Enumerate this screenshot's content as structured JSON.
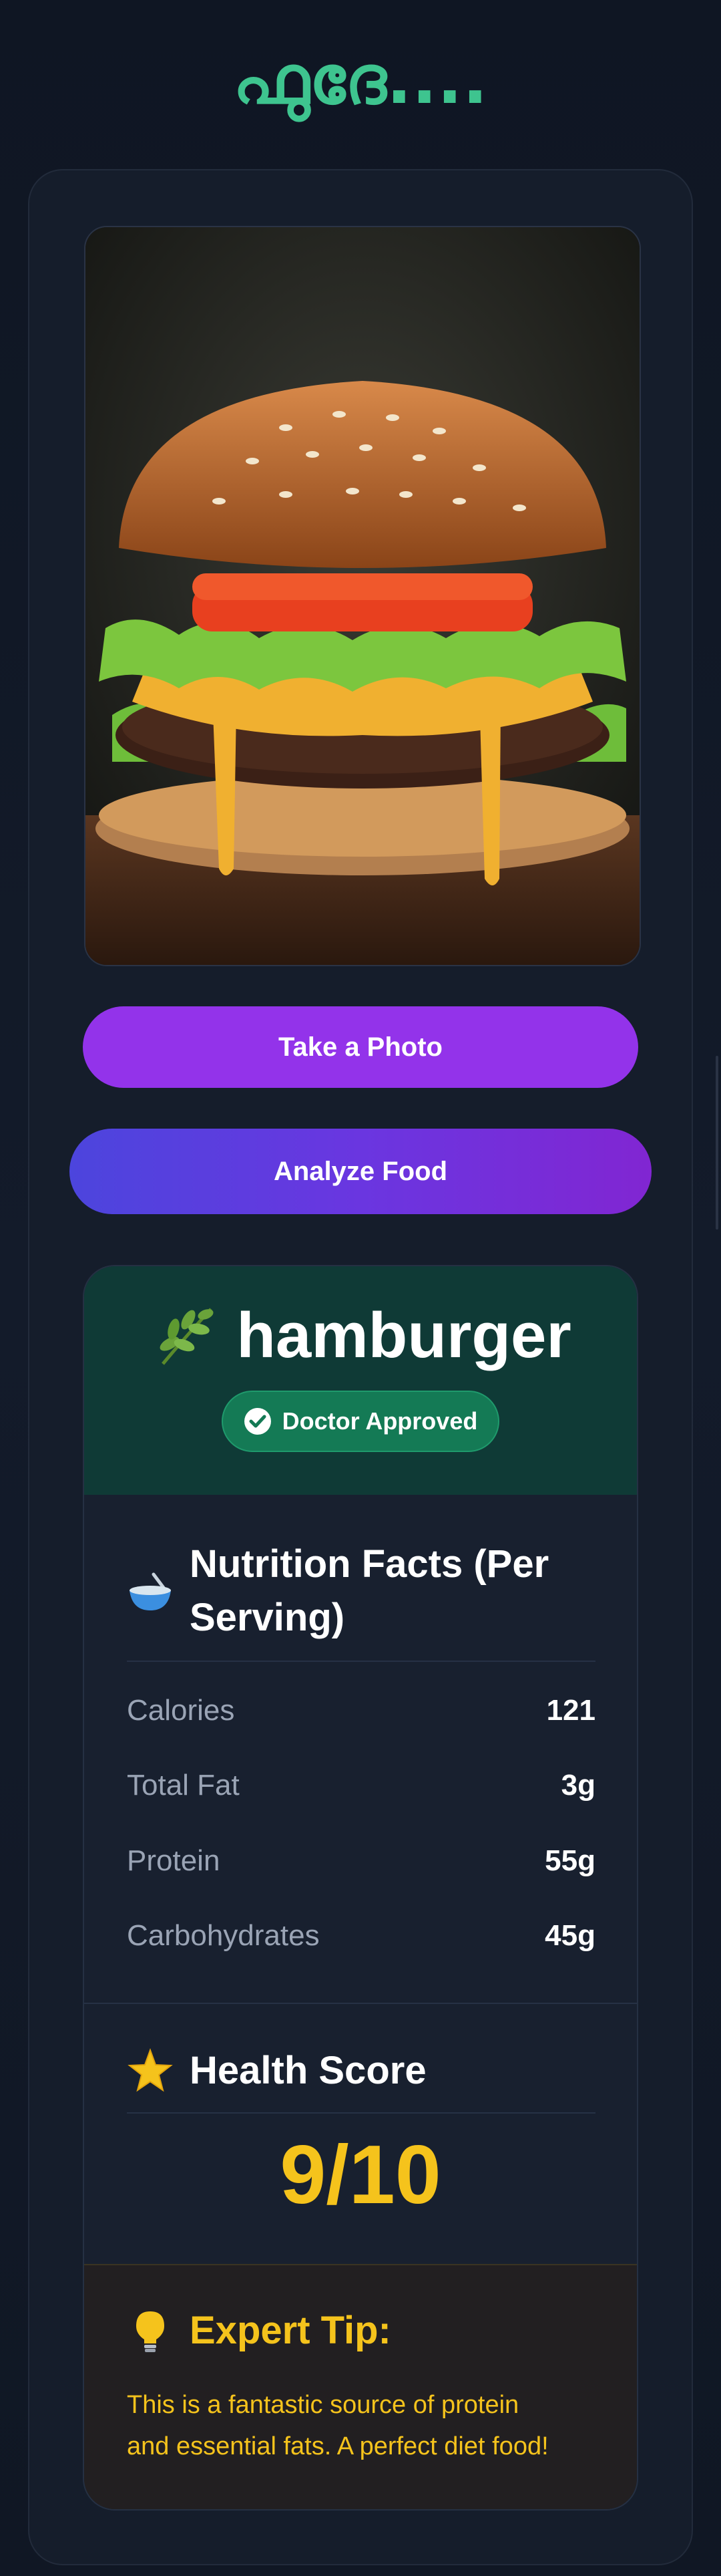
{
  "app": {
    "title": "ഫുദേ...."
  },
  "food_image": {
    "alt": "hamburger"
  },
  "buttons": {
    "take_photo": "Take a Photo",
    "analyze": "Analyze Food"
  },
  "result": {
    "food_name": "hamburger",
    "food_icon": "herb-icon",
    "badge": {
      "icon": "check-circle-icon",
      "label": "Doctor Approved"
    },
    "nutrition": {
      "icon": "bowl-icon",
      "title_line1": "Nutrition Facts (Per",
      "title_line2": "Serving)",
      "rows": [
        {
          "label": "Calories",
          "value": "121"
        },
        {
          "label": "Total Fat",
          "value": "3g"
        },
        {
          "label": "Protein",
          "value": "55g"
        },
        {
          "label": "Carbohydrates",
          "value": "45g"
        }
      ]
    },
    "health": {
      "icon": "star-icon",
      "title": "Health Score",
      "score": "9/10"
    },
    "tip": {
      "icon": "lightbulb-icon",
      "title": "Expert Tip:",
      "line1": "This is a fantastic source of protein",
      "line2": "and essential fats. A perfect diet food!"
    }
  },
  "colors": {
    "title_green": "#3ec48f",
    "accent_purple": "#9333ea",
    "header_green": "#0f3a36",
    "badge_green": "#147a55",
    "score_yellow": "#f5c31c"
  }
}
